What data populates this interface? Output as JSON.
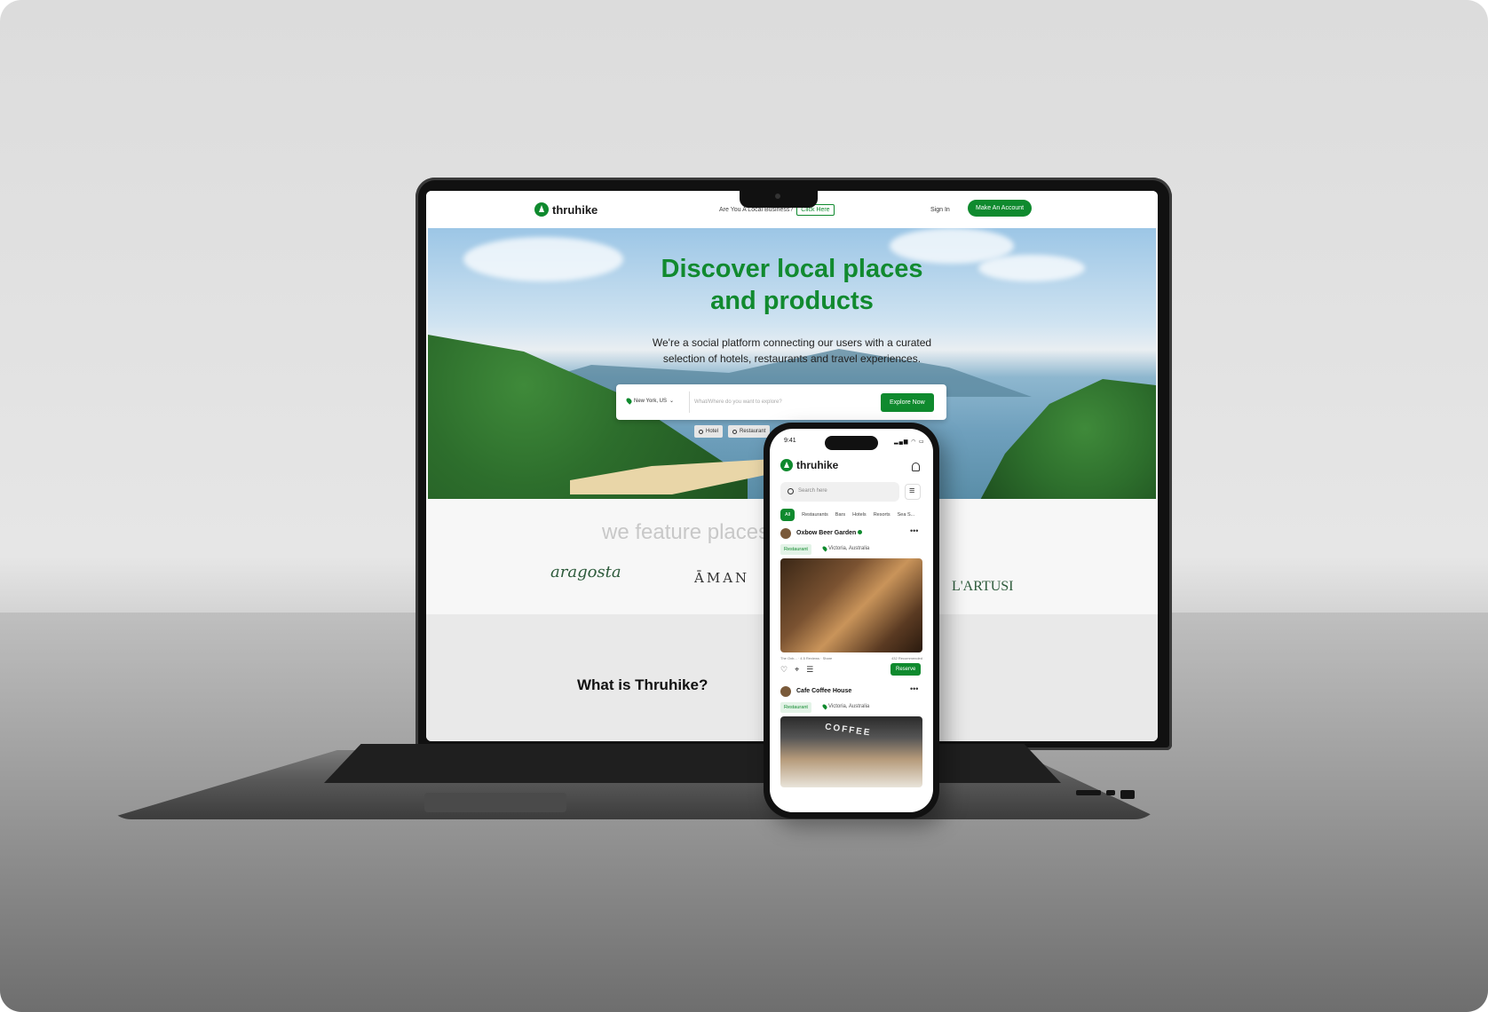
{
  "colors": {
    "brand_green": "#0f8a2e",
    "title_green": "#118a2f",
    "featured_grey": "#c8c8c8"
  },
  "site": {
    "brand": "thruhike",
    "nav": {
      "local_business_prompt": "Are You A Local Business?",
      "click_here": "Click Here",
      "sign_in": "Sign In",
      "make_account": "Make An Account"
    },
    "hero": {
      "title_line1": "Discover local places",
      "title_line2": "and products",
      "subtitle_line1": "We're a social platform connecting our users with a curated",
      "subtitle_line2": "selection of hotels, restaurants and travel experiences.",
      "location": "New York, US",
      "search_placeholder": "What/Where do you want to explore?",
      "explore_button": "Explore Now",
      "chips": [
        "Hotel",
        "Restaurant"
      ]
    },
    "featured": {
      "heading": "we feature places",
      "partners": [
        "aragosta",
        "ĀMAN",
        "L'ARTUSI"
      ]
    },
    "about": {
      "title": "What is Thruhike?"
    }
  },
  "app": {
    "status_time": "9:41",
    "status_icons": "▂▄▆ ◠ ▭",
    "brand": "thruhike",
    "search_placeholder": "Search here",
    "tabs": [
      "All",
      "Restaurants",
      "Bars",
      "Hotels",
      "Resorts",
      "Sea S..."
    ],
    "posts": [
      {
        "name": "Oxbow Beer Garden",
        "badge": "Restaurant",
        "location": "Victoria, Australia",
        "stats_left": "The Oxb... · 4.5 Reviews · Share",
        "stats_right": "432 Recommended",
        "reserve": "Reserve",
        "image": "bar-scene"
      },
      {
        "name": "Cafe Coffee House",
        "badge": "Restaurant",
        "location": "Victoria, Australia",
        "image_sign": "COFFEE",
        "image": "cafe-interior"
      }
    ]
  }
}
